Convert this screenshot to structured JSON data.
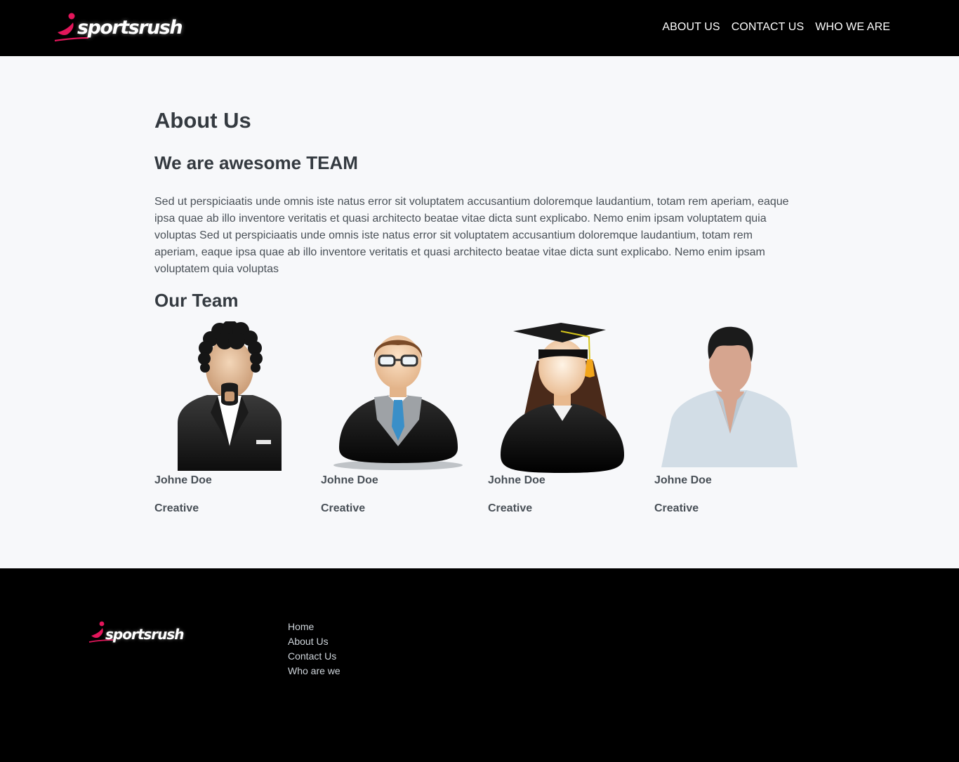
{
  "header": {
    "logo_text": "sportsrush",
    "nav": [
      {
        "label": "ABOUT US"
      },
      {
        "label": "CONTACT US"
      },
      {
        "label": "WHO WE ARE"
      }
    ]
  },
  "main": {
    "title": "About Us",
    "subtitle": "We are awesome TEAM",
    "description": "Sed ut perspiciaatis unde omnis iste natus error sit voluptatem accusantium doloremque laudantium, totam rem aperiam, eaque ipsa quae ab illo inventore veritatis et quasi architecto beatae vitae dicta sunt explicabo. Nemo enim ipsam voluptatem quia voluptas Sed ut perspiciaatis unde omnis iste natus error sit voluptatem accusantium doloremque laudantium, totam rem aperiam, eaque ipsa quae ab illo inventore veritatis et quasi architecto beatae vitae dicta sunt explicabo. Nemo enim ipsam voluptatem quia voluptas",
    "team_heading": "Our Team",
    "team": [
      {
        "name": "Johne Doe",
        "role": "Creative",
        "avatar": "man-curly-hair-suit-icon"
      },
      {
        "name": "Johne Doe",
        "role": "Creative",
        "avatar": "man-glasses-tie-icon"
      },
      {
        "name": "Johne Doe",
        "role": "Creative",
        "avatar": "graduate-woman-icon"
      },
      {
        "name": "Johne Doe",
        "role": "Creative",
        "avatar": "man-casual-shirt-icon"
      }
    ]
  },
  "footer": {
    "logo_text": "sportsrush",
    "links": [
      {
        "label": "Home"
      },
      {
        "label": "About Us"
      },
      {
        "label": "Contact Us"
      },
      {
        "label": "Who are we"
      }
    ]
  },
  "colors": {
    "header_bg": "#000000",
    "page_bg": "#f7f8fa",
    "brand_accent": "#e3165b",
    "heading": "#343a40"
  }
}
